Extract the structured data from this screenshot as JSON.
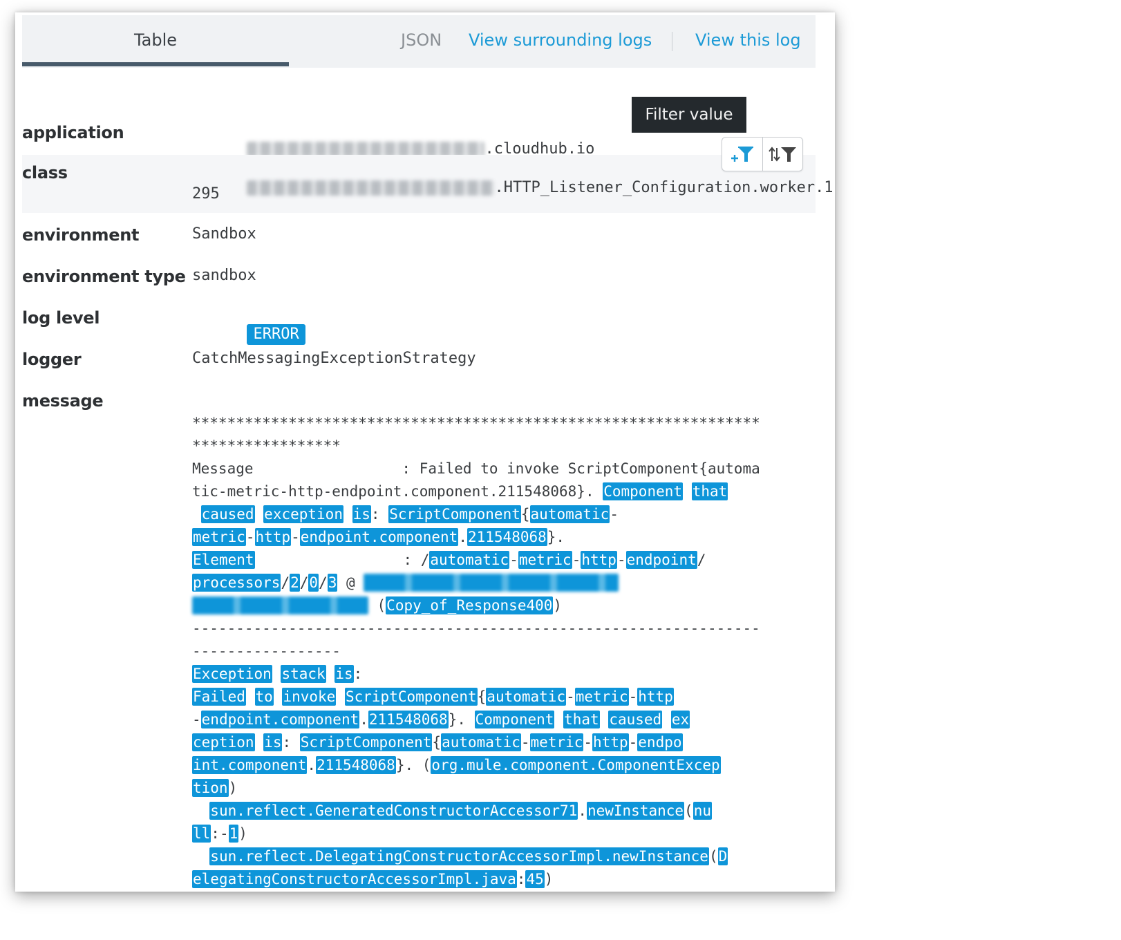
{
  "tabs": {
    "table_label": "Table",
    "json_label": "JSON",
    "active": "Table"
  },
  "links": {
    "surrounding": "View surrounding logs",
    "view_this": "View this log"
  },
  "tooltip": "Filter value",
  "filter_actions": [
    {
      "icon": "add-filter-icon",
      "label": "Add filter"
    },
    {
      "icon": "toggle-filter-icon",
      "label": "Toggle filter"
    }
  ],
  "fields": [
    {
      "key": "application",
      "value_suffix": ".cloudhub.io",
      "redacted": true
    },
    {
      "key": "class",
      "value_suffix": ".HTTP_Listener_Configuration.worker.1",
      "value_line2": "295",
      "redacted": true
    },
    {
      "key": "environment",
      "value": "Sandbox"
    },
    {
      "key": "environment type",
      "value": "sandbox"
    },
    {
      "key": "log level",
      "value": "ERROR"
    },
    {
      "key": "logger",
      "value": "CatchMessagingExceptionStrategy"
    },
    {
      "key": "message",
      "value": ""
    }
  ],
  "colors": {
    "accent": "#0e95d9",
    "link": "#1b9ad6",
    "tab_underline": "#475a6a",
    "tooltip_bg": "#24292d"
  },
  "message_lines": [
    [
      [
        "*****************************************************************",
        0
      ]
    ],
    [
      [
        "*****************",
        0
      ]
    ],
    [
      [
        "Message                 : Failed to invoke ScriptComponent{automa",
        0
      ]
    ],
    [
      [
        "tic-metric-http-endpoint.component.211548068}. ",
        0
      ],
      [
        "Component",
        1
      ],
      [
        " ",
        0
      ],
      [
        "that",
        1
      ]
    ],
    [
      [
        " ",
        0
      ],
      [
        "caused",
        1
      ],
      [
        " ",
        0
      ],
      [
        "exception",
        1
      ],
      [
        " ",
        0
      ],
      [
        "is",
        1
      ],
      [
        ": ",
        0
      ],
      [
        "ScriptComponent",
        1
      ],
      [
        "{",
        0
      ],
      [
        "automatic",
        1
      ],
      [
        "-",
        0
      ]
    ],
    [
      [
        "metric",
        1
      ],
      [
        "-",
        0
      ],
      [
        "http",
        1
      ],
      [
        "-",
        0
      ],
      [
        "endpoint.component",
        1
      ],
      [
        ".",
        0
      ],
      [
        "211548068",
        1
      ],
      [
        "}.",
        0
      ]
    ],
    [
      [
        "Element",
        1
      ],
      [
        "                 : /",
        0
      ],
      [
        "automatic",
        1
      ],
      [
        "-",
        0
      ],
      [
        "metric",
        1
      ],
      [
        "-",
        0
      ],
      [
        "http",
        1
      ],
      [
        "-",
        0
      ],
      [
        "endpoint",
        1
      ],
      [
        "/",
        0
      ]
    ],
    [
      [
        "processors",
        1
      ],
      [
        "/",
        0
      ],
      [
        "2",
        1
      ],
      [
        "/",
        0
      ],
      [
        "0",
        1
      ],
      [
        "/",
        0
      ],
      [
        "3",
        1
      ],
      [
        " @ ",
        0
      ],
      [
        "redacted-host-name-value-here",
        2
      ]
    ],
    [
      [
        "redacted-text-values",
        2
      ],
      [
        " (",
        0
      ],
      [
        "Copy_of_Response400",
        1
      ],
      [
        ")",
        0
      ]
    ],
    [
      [
        "-----------------------------------------------------------------",
        0
      ]
    ],
    [
      [
        "-----------------",
        0
      ]
    ],
    [
      [
        "Exception",
        1
      ],
      [
        " ",
        0
      ],
      [
        "stack",
        1
      ],
      [
        " ",
        0
      ],
      [
        "is",
        1
      ],
      [
        ":",
        0
      ]
    ],
    [
      [
        "Failed",
        1
      ],
      [
        " ",
        0
      ],
      [
        "to",
        1
      ],
      [
        " ",
        0
      ],
      [
        "invoke",
        1
      ],
      [
        " ",
        0
      ],
      [
        "ScriptComponent",
        1
      ],
      [
        "{",
        0
      ],
      [
        "automatic",
        1
      ],
      [
        "-",
        0
      ],
      [
        "metric",
        1
      ],
      [
        "-",
        0
      ],
      [
        "http",
        1
      ]
    ],
    [
      [
        "-",
        0
      ],
      [
        "endpoint.component",
        1
      ],
      [
        ".",
        0
      ],
      [
        "211548068",
        1
      ],
      [
        "}. ",
        0
      ],
      [
        "Component",
        1
      ],
      [
        " ",
        0
      ],
      [
        "that",
        1
      ],
      [
        " ",
        0
      ],
      [
        "caused",
        1
      ],
      [
        " ",
        0
      ],
      [
        "ex",
        1
      ]
    ],
    [
      [
        "ception",
        1
      ],
      [
        " ",
        0
      ],
      [
        "is",
        1
      ],
      [
        ": ",
        0
      ],
      [
        "ScriptComponent",
        1
      ],
      [
        "{",
        0
      ],
      [
        "automatic",
        1
      ],
      [
        "-",
        0
      ],
      [
        "metric",
        1
      ],
      [
        "-",
        0
      ],
      [
        "http",
        1
      ],
      [
        "-",
        0
      ],
      [
        "endpo",
        1
      ]
    ],
    [
      [
        "int.component",
        1
      ],
      [
        ".",
        0
      ],
      [
        "211548068",
        1
      ],
      [
        "}. (",
        0
      ],
      [
        "org.mule.component.ComponentExcep",
        1
      ]
    ],
    [
      [
        "tion",
        1
      ],
      [
        ")",
        0
      ]
    ],
    [
      [
        "  ",
        0
      ],
      [
        "sun.reflect.GeneratedConstructorAccessor71",
        1
      ],
      [
        ".",
        0
      ],
      [
        "newInstance",
        1
      ],
      [
        "(",
        0
      ],
      [
        "nu",
        1
      ]
    ],
    [
      [
        "ll",
        1
      ],
      [
        ":-",
        0
      ],
      [
        "1",
        1
      ],
      [
        ")",
        0
      ]
    ],
    [
      [
        "  ",
        0
      ],
      [
        "sun.reflect.DelegatingConstructorAccessorImpl.newInstance",
        1
      ],
      [
        "(",
        0
      ],
      [
        "D",
        1
      ]
    ],
    [
      [
        "elegatingConstructorAccessorImpl.java",
        1
      ],
      [
        ":",
        0
      ],
      [
        "45",
        1
      ],
      [
        ")",
        0
      ]
    ]
  ]
}
